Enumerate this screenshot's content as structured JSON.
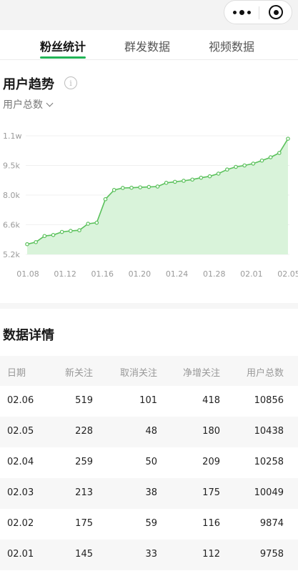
{
  "tabs": [
    {
      "label": "粉丝统计",
      "active": true
    },
    {
      "label": "群发数据",
      "active": false
    },
    {
      "label": "视频数据",
      "active": false
    }
  ],
  "trend": {
    "title": "用户趋势",
    "info_icon": "info-icon",
    "metric": "用户总数"
  },
  "chart_data": {
    "type": "area",
    "y_ticks": [
      "1.1w",
      "9.5k",
      "8.0k",
      "6.6k",
      "5.2k"
    ],
    "ylim": [
      5200,
      11000
    ],
    "x_ticks": [
      "01.08",
      "01.12",
      "01.16",
      "01.20",
      "01.24",
      "01.28",
      "02.01",
      "02.05"
    ],
    "x": [
      "01.08",
      "01.09",
      "01.10",
      "01.11",
      "01.12",
      "01.13",
      "01.14",
      "01.15",
      "01.16",
      "01.17",
      "01.18",
      "01.19",
      "01.20",
      "01.21",
      "01.22",
      "01.23",
      "01.24",
      "01.25",
      "01.26",
      "01.27",
      "01.28",
      "01.29",
      "01.30",
      "01.31",
      "02.01",
      "02.02",
      "02.03",
      "02.04",
      "02.05",
      "02.06"
    ],
    "values": [
      5700,
      5800,
      6100,
      6150,
      6300,
      6350,
      6380,
      6700,
      6750,
      7900,
      8350,
      8450,
      8460,
      8480,
      8500,
      8520,
      8700,
      8750,
      8800,
      8860,
      8950,
      9020,
      9150,
      9350,
      9480,
      9550,
      9640,
      9790,
      9950,
      10160,
      10856
    ],
    "colors": {
      "line": "#5ac15b",
      "fill": "#d9f3da",
      "point_fill": "#ffffff"
    }
  },
  "details": {
    "title": "数据详情",
    "columns": [
      "日期",
      "新关注",
      "取消关注",
      "净增关注",
      "用户总数"
    ],
    "rows": [
      [
        "02.06",
        "519",
        "101",
        "418",
        "10856"
      ],
      [
        "02.05",
        "228",
        "48",
        "180",
        "10438"
      ],
      [
        "02.04",
        "259",
        "50",
        "209",
        "10258"
      ],
      [
        "02.03",
        "213",
        "38",
        "175",
        "10049"
      ],
      [
        "02.02",
        "175",
        "59",
        "116",
        "9874"
      ],
      [
        "02.01",
        "145",
        "33",
        "112",
        "9758"
      ]
    ]
  }
}
